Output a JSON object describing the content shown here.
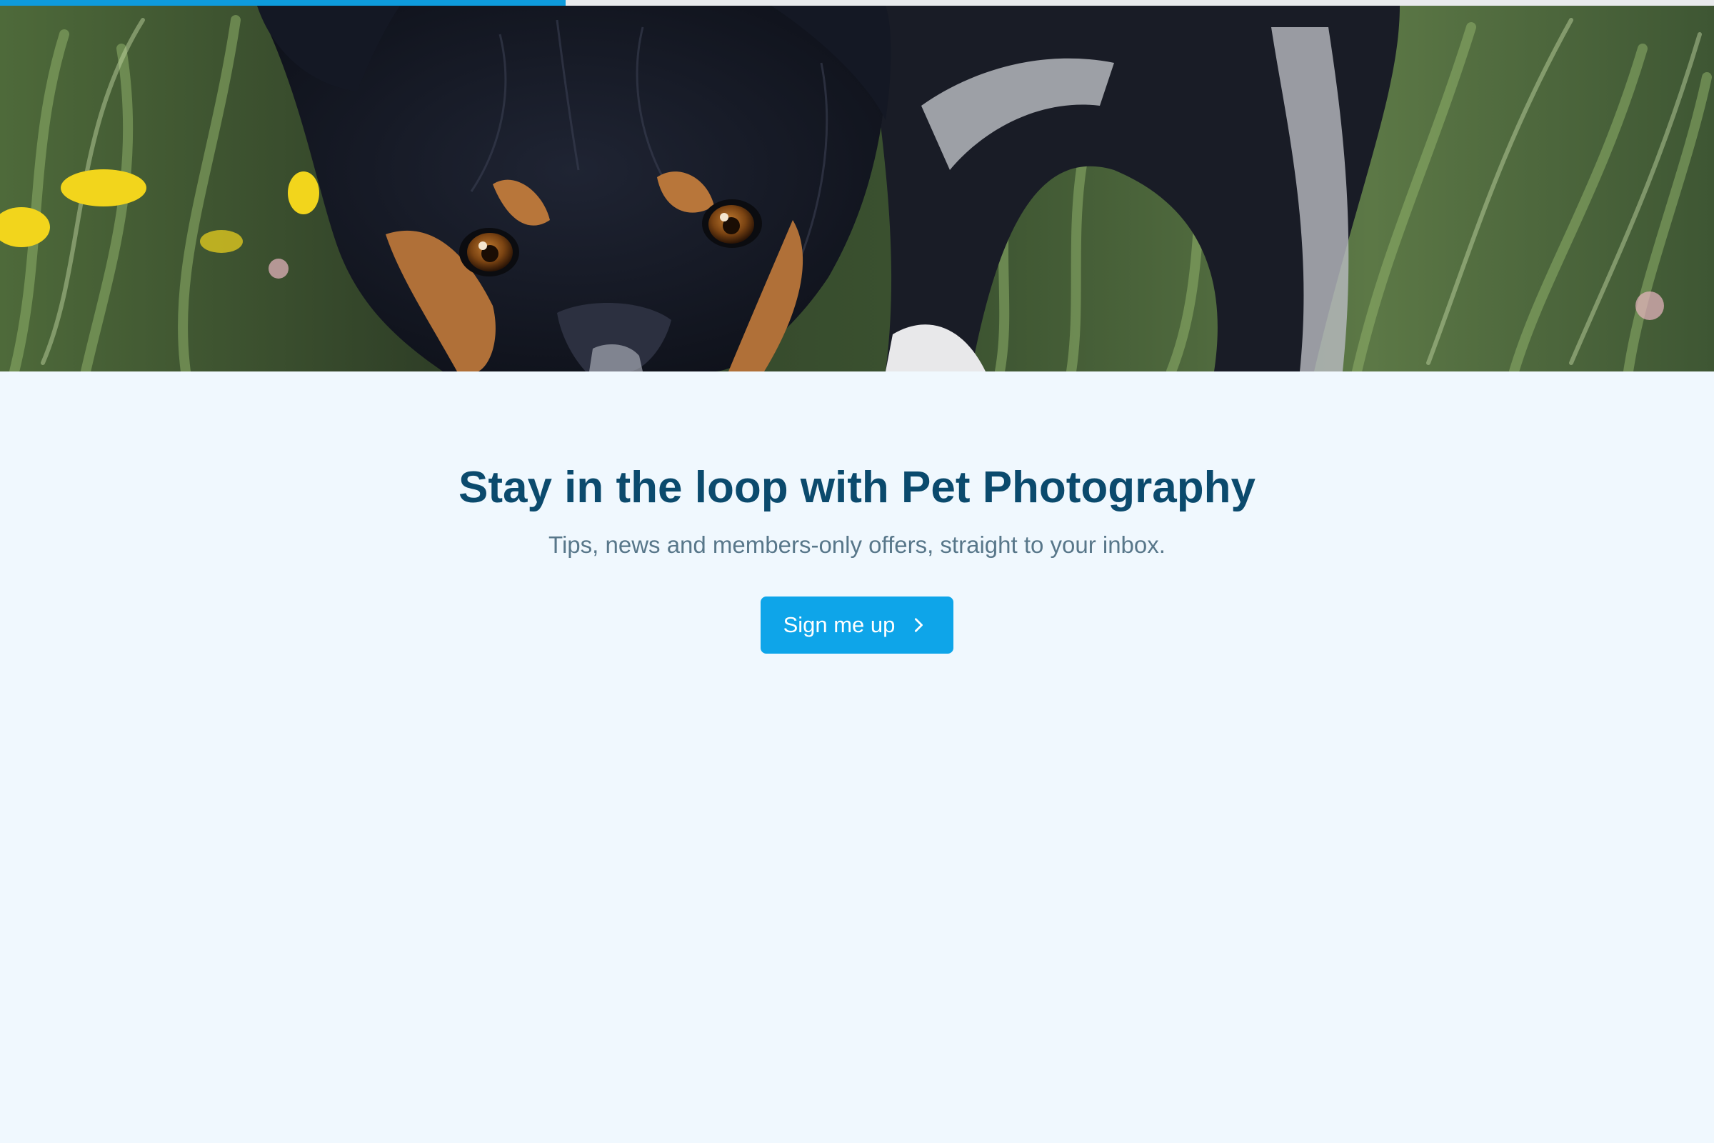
{
  "progress": {
    "fraction": 0.33,
    "color": "#0e9bdc"
  },
  "hero": {
    "image": "photo of a black and tan dog peering over garden plants and yellow flowers"
  },
  "newsletter": {
    "title": "Stay in the loop with Pet Photography",
    "subtitle": "Tips, news and members-only offers, straight to your inbox.",
    "cta_label": "Sign me up",
    "cta_icon": "chevron-right-icon",
    "accent": "#0ea5e9",
    "title_color": "#0b4a6d"
  }
}
